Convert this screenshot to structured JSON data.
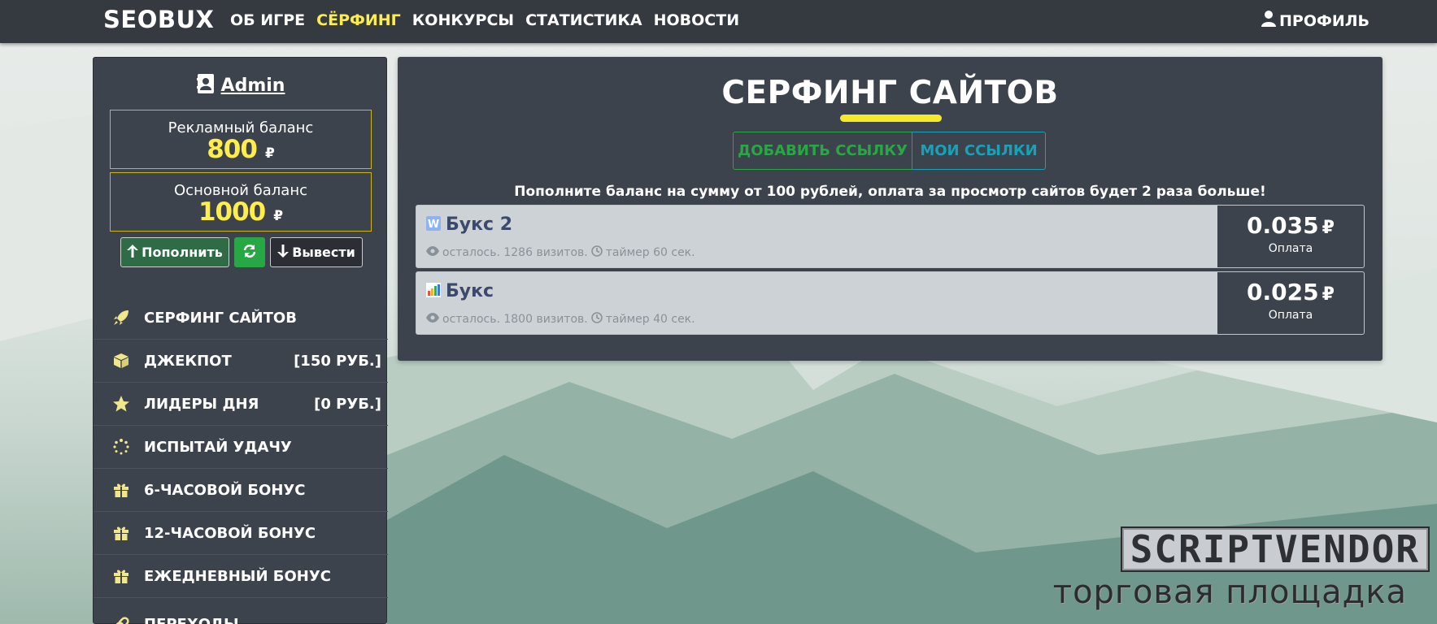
{
  "navbar": {
    "brand": "SEOBUX",
    "links": [
      {
        "label": "ОБ ИГРЕ",
        "active": false
      },
      {
        "label": "СЁРФИНГ",
        "active": true
      },
      {
        "label": "КОНКУРСЫ",
        "active": false
      },
      {
        "label": "СТАТИСТИКА",
        "active": false
      },
      {
        "label": "НОВОСТИ",
        "active": false
      }
    ],
    "profile_label": "ПРОФИЛЬ"
  },
  "sidebar": {
    "username": "Admin",
    "ad_balance": {
      "label": "Рекламный баланс",
      "amount": "800",
      "currency": "₽"
    },
    "main_balance": {
      "label": "Основной баланс",
      "amount": "1000",
      "currency": "₽"
    },
    "buttons": {
      "deposit": "Пополнить",
      "withdraw": "Вывести"
    },
    "menu": [
      {
        "label": "СЕРФИНГ САЙТОВ",
        "right": "",
        "icon": "rocket-icon"
      },
      {
        "label": "ДЖЕКПОТ",
        "right": "[150 РУБ.]",
        "icon": "cube-icon"
      },
      {
        "label": "ЛИДЕРЫ ДНЯ",
        "right": "[0 РУБ.]",
        "icon": "star-icon"
      },
      {
        "label": "ИСПЫТАЙ УДАЧУ",
        "right": "",
        "icon": "spinner-icon"
      },
      {
        "label": "6-ЧАСОВОЙ БОНУС",
        "right": "",
        "icon": "gift-icon"
      },
      {
        "label": "12-ЧАСОВОЙ БОНУС",
        "right": "",
        "icon": "gift-icon"
      },
      {
        "label": "ЕЖЕДНЕВНЫЙ БОНУС",
        "right": "",
        "icon": "gift-icon"
      },
      {
        "label": "ПЕРЕХОДЫ",
        "right": "",
        "icon": "link-icon"
      }
    ]
  },
  "main": {
    "title": "СЕРФИНГ САЙТОВ",
    "add_link": "ДОБАВИТЬ ССЫЛКУ",
    "my_links": "МОИ ССЫЛКИ",
    "notice": "Пополните баланс на сумму от 100 рублей, оплата за просмотр сайтов будет 2 раза больше!",
    "sites": [
      {
        "name": "Букс 2",
        "icon": "w-site-icon",
        "remaining": "осталось. 1286 визитов.",
        "timer": "таймер 60 сек.",
        "price": "0.035",
        "currency": "₽",
        "pay_label": "Оплата"
      },
      {
        "name": "Букс",
        "icon": "chart-site-icon",
        "remaining": "осталось. 1800 визитов.",
        "timer": "таймер 40 сек.",
        "price": "0.025",
        "currency": "₽",
        "pay_label": "Оплата"
      }
    ]
  },
  "watermark": {
    "top": "SCRIPTVENDOR",
    "bottom": "торговая площадка"
  }
}
